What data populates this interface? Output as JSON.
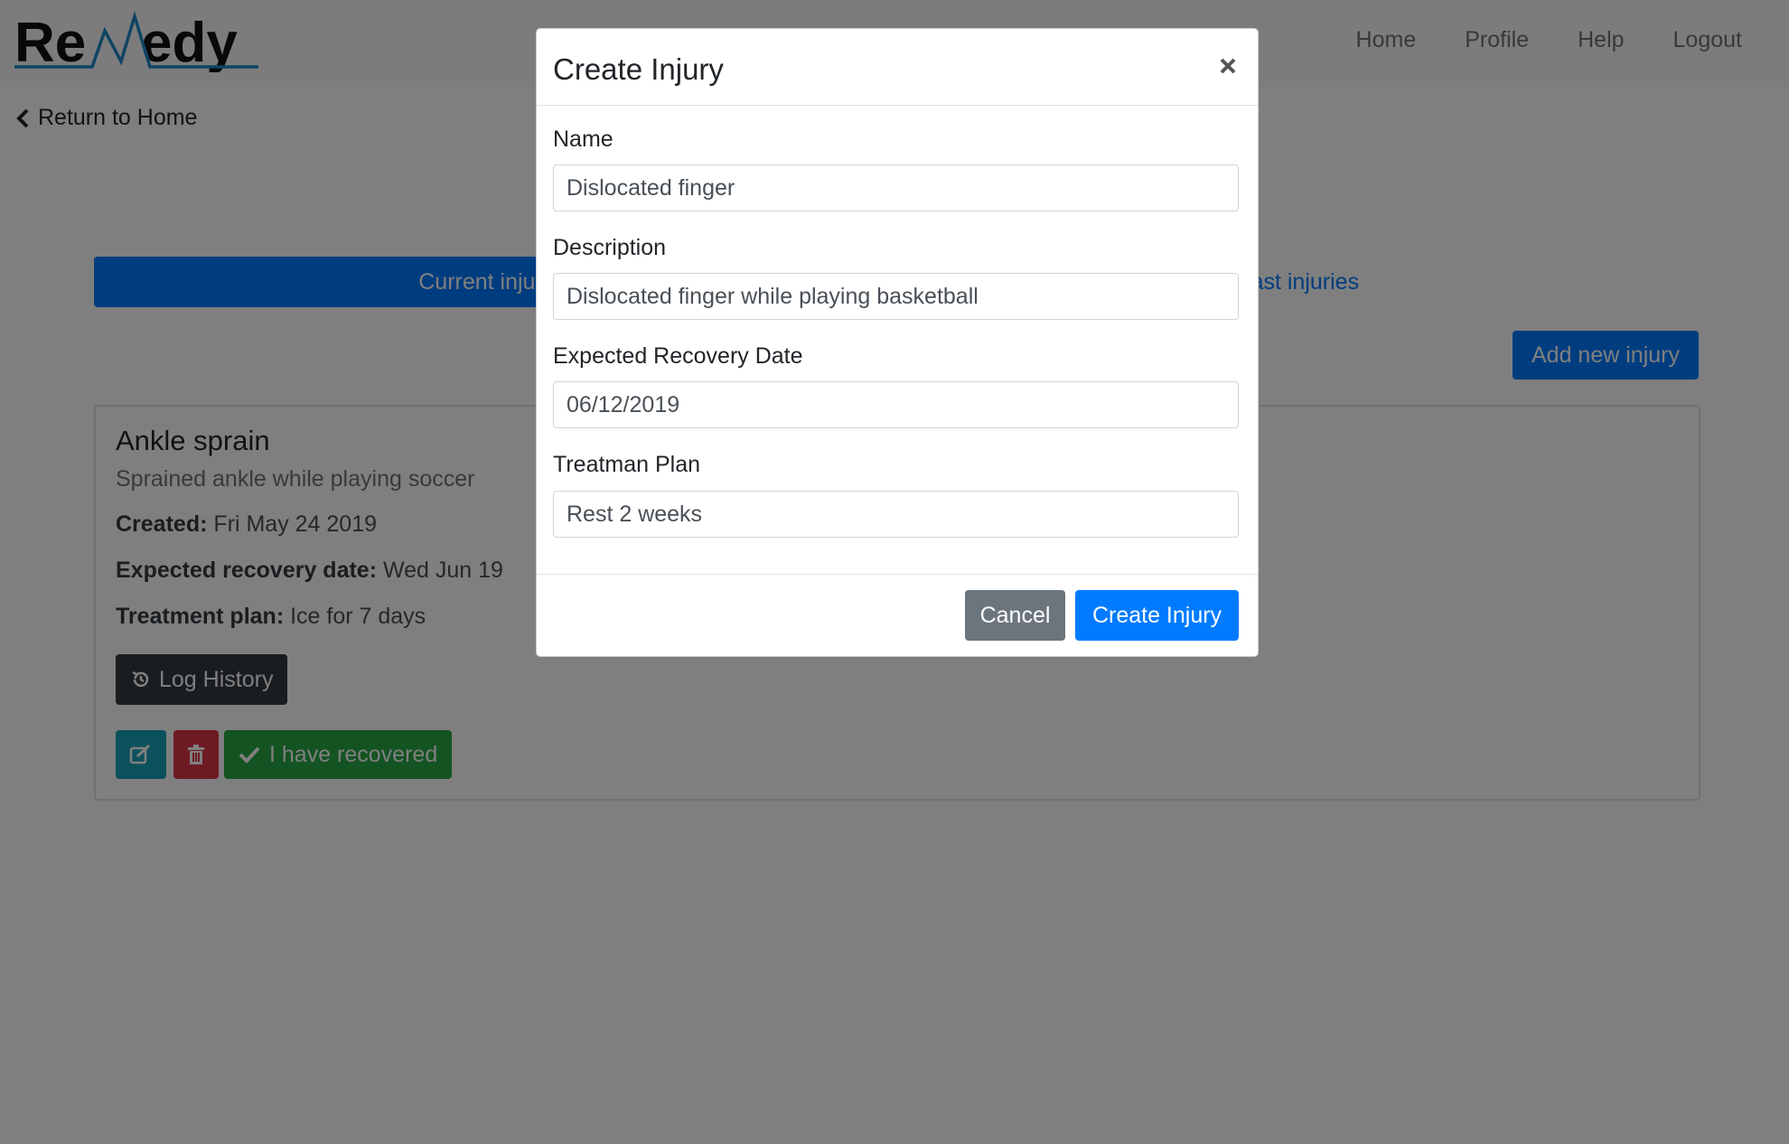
{
  "brand": {
    "logo_text": "ReMedy",
    "logo_colors": {
      "text": "#111111",
      "accent": "#1e88c8"
    }
  },
  "nav": {
    "links": [
      {
        "label": "Home"
      },
      {
        "label": "Profile"
      },
      {
        "label": "Help"
      },
      {
        "label": "Logout"
      }
    ]
  },
  "back_link": {
    "label": "Return to Home",
    "icon": "chevron-left-icon"
  },
  "tabs": [
    {
      "label": "Current injuries",
      "active": true
    },
    {
      "label": "Past injuries",
      "active": false
    }
  ],
  "add_button": {
    "label": "Add new injury"
  },
  "injury_card": {
    "title": "Ankle sprain",
    "description": "Sprained ankle while playing soccer",
    "created_label": "Created:",
    "created_value": "Fri May 24 2019",
    "recovery_label": "Expected recovery date:",
    "recovery_value": "Wed Jun 19",
    "treatment_label": "Treatment plan:",
    "treatment_value": "Ice for 7 days",
    "log_history_label": "Log History",
    "recovered_label": "I have recovered"
  },
  "modal": {
    "title": "Create Injury",
    "close_icon": "×",
    "fields": {
      "name": {
        "label": "Name",
        "value": "Dislocated finger"
      },
      "description": {
        "label": "Description",
        "value": "Dislocated finger while playing basketball"
      },
      "recovery_date": {
        "label": "Expected Recovery Date",
        "value": "06/12/2019"
      },
      "treatment": {
        "label": "Treatman Plan",
        "value": "Rest 2 weeks"
      }
    },
    "cancel_label": "Cancel",
    "create_label": "Create Injury"
  },
  "colors": {
    "primary": "#007bff",
    "secondary": "#6c757d",
    "dark": "#343a40",
    "info": "#17a2b8",
    "danger": "#dc3545",
    "success": "#28a745",
    "backdrop": "rgba(0,0,0,0.5)"
  }
}
